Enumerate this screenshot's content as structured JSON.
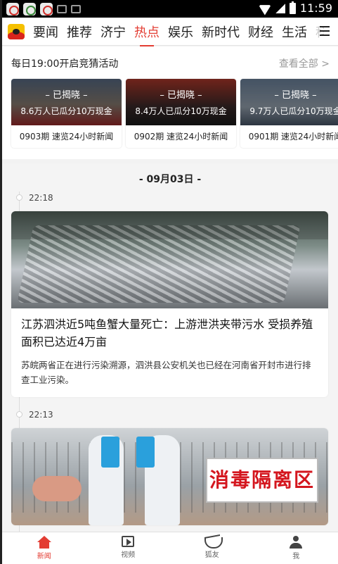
{
  "status_bar": {
    "time": "11:59"
  },
  "channels": [
    "要闻",
    "推荐",
    "济宁",
    "热点",
    "娱乐",
    "新时代",
    "财经",
    "生活",
    "科"
  ],
  "active_channel": "热点",
  "guess_module": {
    "title": "每日19:00开启竞猜活动",
    "view_all": "查看全部 >",
    "cards": [
      {
        "status": "– 已揭晓 –",
        "sub": "8.6万人已瓜分10万现金",
        "label": "0903期 速览24小时新闻"
      },
      {
        "status": "– 已揭晓 –",
        "sub": "8.4万人已瓜分10万现金",
        "label": "0902期 速览24小时新闻"
      },
      {
        "status": "– 已揭晓 –",
        "sub": "9.7万人已瓜分10万现金",
        "label": "0901期 速览24小时新闻"
      }
    ]
  },
  "feed": {
    "date": "- 09月03日 -",
    "items": [
      {
        "time": "22:18",
        "title": "江苏泗洪近5吨鱼蟹大量死亡：上游泄洪夹带污水 受损养殖面积已达近4万亩",
        "summary": "苏皖两省正在进行污染溯源，泗洪县公安机关也已经在河南省开封市进行排查工业污染。"
      },
      {
        "time": "22:13",
        "sign_text": "消毒隔离区"
      }
    ]
  },
  "bottom_nav": [
    {
      "label": "新闻",
      "icon": "home-icon",
      "active": true
    },
    {
      "label": "视频",
      "icon": "video-icon",
      "active": false
    },
    {
      "label": "狐友",
      "icon": "fox-icon",
      "active": false
    },
    {
      "label": "我",
      "icon": "person-icon",
      "active": false
    }
  ],
  "colors": {
    "accent": "#e33d33"
  }
}
